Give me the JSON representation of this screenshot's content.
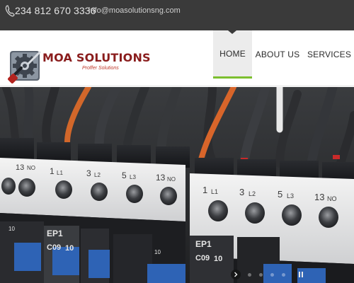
{
  "topbar": {
    "phone": "234 812 670 3336",
    "email": "info@moasolutionsng.com",
    "phone_icon": "phone-icon"
  },
  "brand": {
    "name": "MOA SOLUTIONS",
    "tagline": "Proffer Solutions",
    "logo_icon": "gear-with-tools-icon",
    "colors": {
      "primary": "#8a1d1d",
      "accent": "#c0392b"
    }
  },
  "nav": {
    "active": "HOME",
    "items": [
      {
        "label": "HOME"
      },
      {
        "label": "ABOUT US"
      },
      {
        "label": "SERVICES"
      }
    ],
    "active_indicator_color": "#7cbf2f"
  },
  "hero": {
    "alt": "Electrical contactors and wiring",
    "labels": {
      "terminals_row_1": [
        "1",
        "L1",
        "3",
        "L2",
        "5",
        "L3",
        "13",
        "NO"
      ],
      "terminals_row_2": [
        "1",
        "L1",
        "3",
        "L2",
        "5",
        "L3",
        "13",
        "NO"
      ],
      "module_1": {
        "code": "EP1",
        "model": "C09",
        "rating": "10"
      },
      "module_2": {
        "code": "EP1",
        "model": "C09",
        "rating": "10"
      },
      "small_10_a": "10",
      "small_10_b": "10",
      "partial_13": "13",
      "partial_no": "NO"
    }
  },
  "slider": {
    "controls": [
      "next-arrow-icon",
      "pause-icon"
    ],
    "slide_count": 4,
    "active_index": 1
  }
}
